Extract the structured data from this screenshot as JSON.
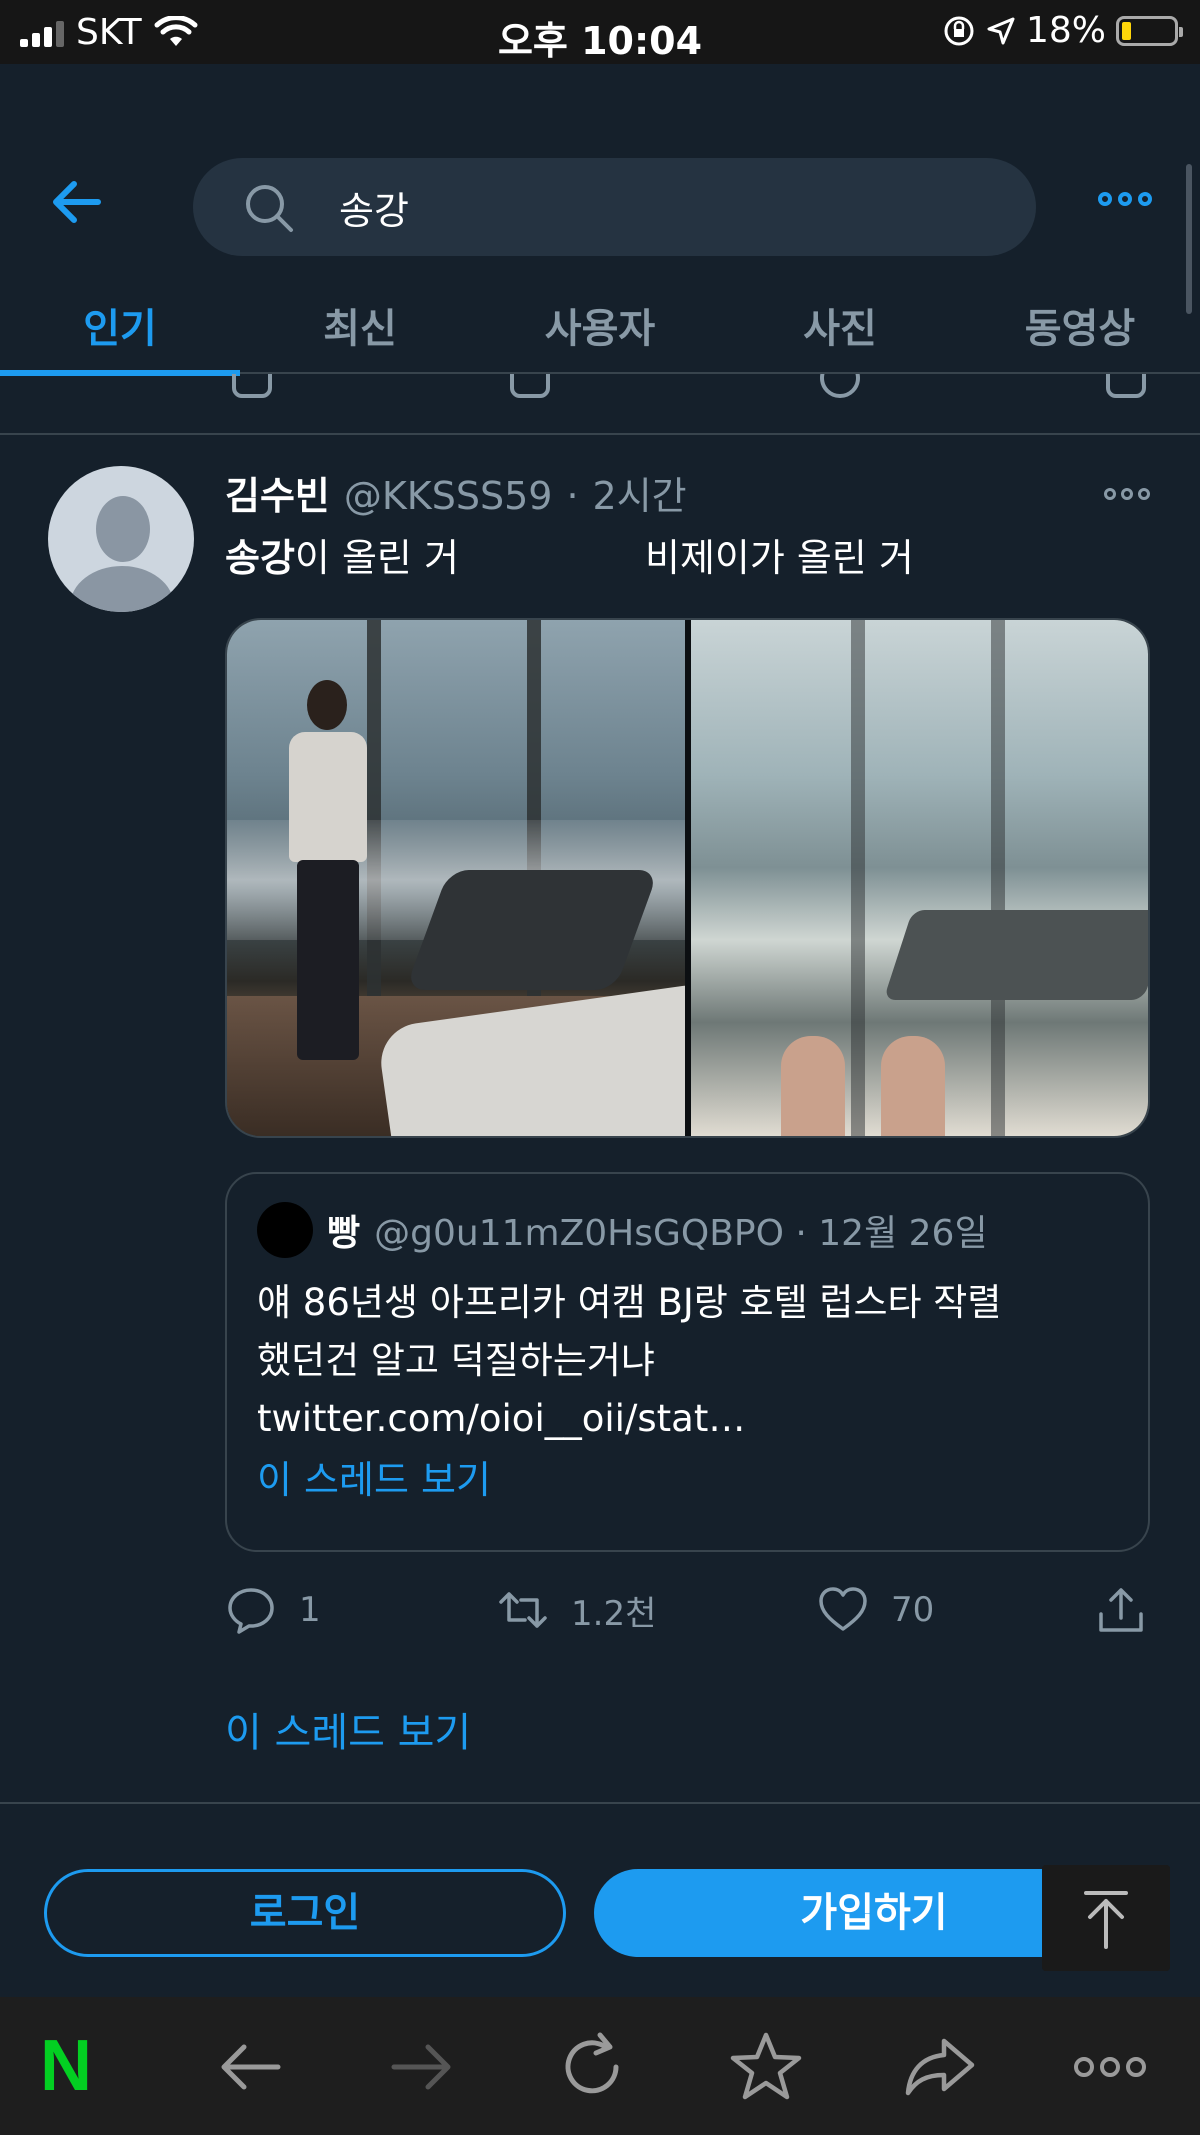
{
  "status_bar": {
    "carrier": "SKT",
    "time": "오후 10:04",
    "battery": "18%",
    "battery_level": 0.18,
    "battery_color": "#ffd60a"
  },
  "header": {
    "search_value": "송강",
    "tabs": [
      {
        "label": "인기",
        "active": true
      },
      {
        "label": "최신",
        "active": false
      },
      {
        "label": "사용자",
        "active": false
      },
      {
        "label": "사진",
        "active": false
      },
      {
        "label": "동영상",
        "active": false
      }
    ],
    "accent_color": "#1d9bf0"
  },
  "tweet": {
    "name": "김수빈",
    "handle": "@KKSSS59",
    "separator": "·",
    "time": "2시간",
    "text_keyword": "송강",
    "text_left_rest": "이 올린 거",
    "text_right": "비제이가 올린 거",
    "quote": {
      "name": "빵",
      "handle_time": "@g0u11mZ0HsGQBPO · 12월 26일",
      "line1": "얘 86년생 아프리카 여캠 BJ랑 호텔 럽스타 작렬",
      "line2": "했던건 알고 덕질하는거냐",
      "line3": "twitter.com/oioi__oii/stat…",
      "thread_link": "이 스레드 보기"
    },
    "actions": {
      "reply_count": "1",
      "retweet_count": "1.2천",
      "like_count": "70"
    },
    "thread_link": "이 스레드 보기"
  },
  "login_bar": {
    "login": "로그인",
    "signup": "가입하기"
  },
  "browser_bar": {
    "logo": "N",
    "icons": [
      "back-icon",
      "forward-icon",
      "refresh-icon",
      "star-icon",
      "share-icon",
      "more-icon"
    ]
  }
}
